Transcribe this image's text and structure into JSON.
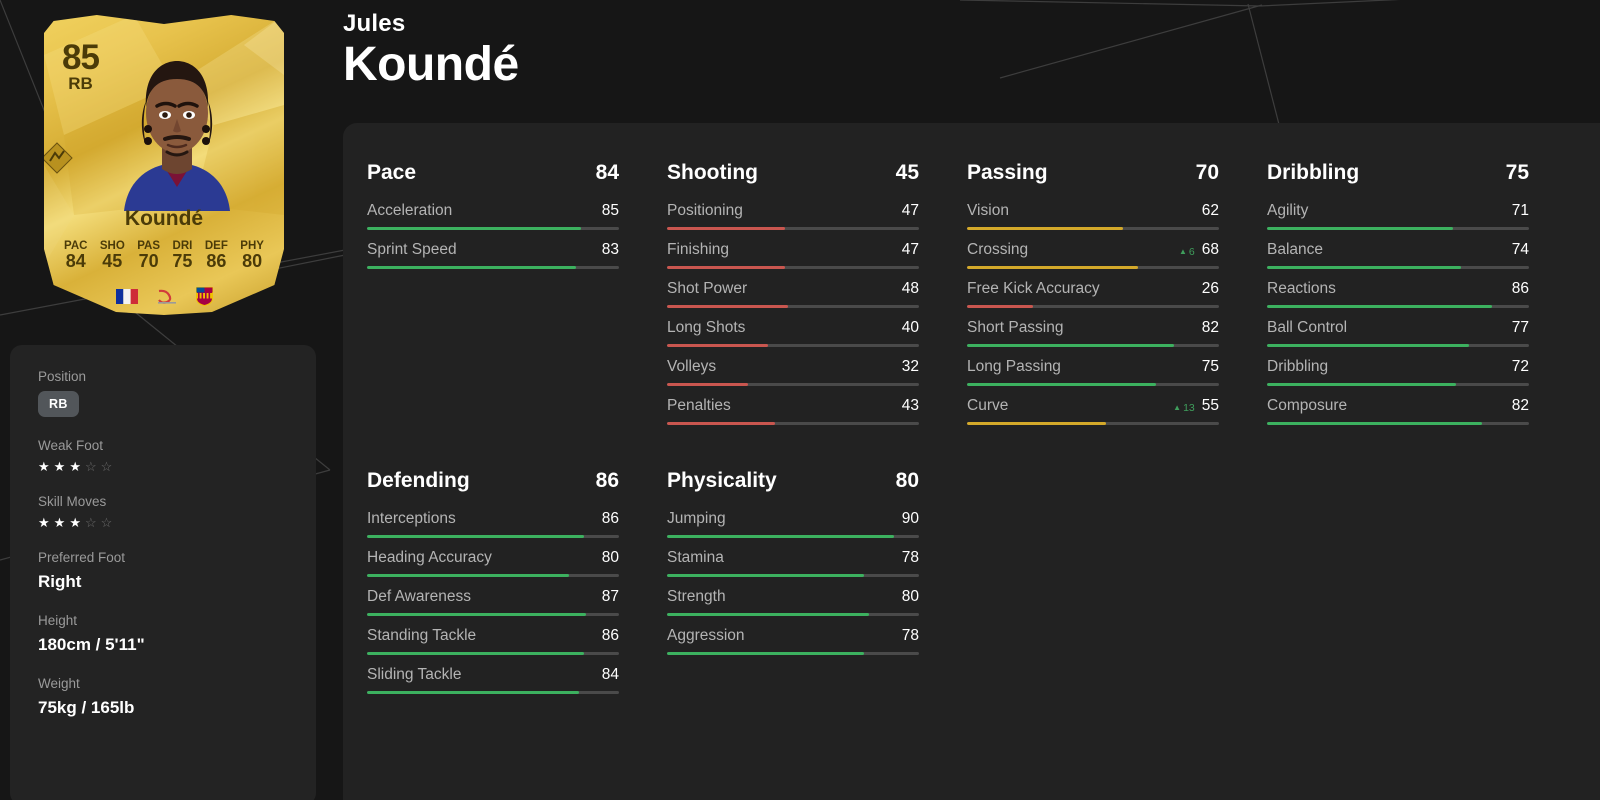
{
  "colors": {
    "background": "#161616",
    "panel": "#222222",
    "info_panel": "#232323",
    "bar_track": "#4a4a4a",
    "green": "#3cb15f",
    "yellow": "#d4a92a",
    "red": "#c9564f",
    "text_primary": "#ffffff",
    "text_muted": "#b4b4b4",
    "card_gold": "#e8c34d"
  },
  "header": {
    "first_name": "Jules",
    "last_name": "Koundé"
  },
  "card": {
    "rating": "85",
    "position": "RB",
    "name": "Koundé",
    "emblem_icon": "club-emblem-icon",
    "photo_icon": "player-photo",
    "stats": [
      {
        "label": "PAC",
        "value": "84"
      },
      {
        "label": "SHO",
        "value": "45"
      },
      {
        "label": "PAS",
        "value": "70"
      },
      {
        "label": "DRI",
        "value": "75"
      },
      {
        "label": "DEF",
        "value": "86"
      },
      {
        "label": "PHY",
        "value": "80"
      }
    ],
    "badges": [
      {
        "name": "nation-flag-france-icon"
      },
      {
        "name": "league-laliga-icon"
      },
      {
        "name": "club-barcelona-crest-icon"
      }
    ]
  },
  "info": {
    "position": {
      "label": "Position",
      "value": "RB"
    },
    "weak_foot": {
      "label": "Weak Foot",
      "value": 3,
      "max": 5
    },
    "skill_moves": {
      "label": "Skill Moves",
      "value": 3,
      "max": 5
    },
    "preferred_foot": {
      "label": "Preferred Foot",
      "value": "Right"
    },
    "height": {
      "label": "Height",
      "value": "180cm / 5'11\""
    },
    "weight": {
      "label": "Weight",
      "value": "75kg / 165lb"
    }
  },
  "chart_data": {
    "type": "bar",
    "title": "Jules Koundé — FC 25 Player Attributes",
    "ylim": [
      0,
      99
    ],
    "grid": false,
    "legend": "none",
    "categories": [
      "Pace",
      "Shooting",
      "Passing",
      "Dribbling",
      "Defending",
      "Physicality"
    ],
    "values": [
      84,
      45,
      70,
      75,
      86,
      80
    ],
    "series": [
      {
        "name": "Pace",
        "total": 84,
        "values": [
          85,
          83
        ],
        "categories": [
          "Acceleration",
          "Sprint Speed"
        ]
      },
      {
        "name": "Shooting",
        "total": 45,
        "values": [
          47,
          47,
          48,
          40,
          32,
          43
        ],
        "categories": [
          "Positioning",
          "Finishing",
          "Shot Power",
          "Long Shots",
          "Volleys",
          "Penalties"
        ]
      },
      {
        "name": "Passing",
        "total": 70,
        "values": [
          62,
          68,
          26,
          82,
          75,
          55
        ],
        "categories": [
          "Vision",
          "Crossing",
          "Free Kick Accuracy",
          "Short Passing",
          "Long Passing",
          "Curve"
        ]
      },
      {
        "name": "Dribbling",
        "total": 75,
        "values": [
          71,
          74,
          86,
          77,
          72,
          82
        ],
        "categories": [
          "Agility",
          "Balance",
          "Reactions",
          "Ball Control",
          "Dribbling",
          "Composure"
        ]
      },
      {
        "name": "Defending",
        "total": 86,
        "values": [
          86,
          80,
          87,
          86,
          84
        ],
        "categories": [
          "Interceptions",
          "Heading Accuracy",
          "Def Awareness",
          "Standing Tackle",
          "Sliding Tackle"
        ]
      },
      {
        "name": "Physicality",
        "total": 80,
        "values": [
          90,
          78,
          80,
          78
        ],
        "categories": [
          "Jumping",
          "Stamina",
          "Strength",
          "Aggression"
        ]
      }
    ]
  },
  "categories": {
    "row1": [
      {
        "name": "Pace",
        "total": "84",
        "subs": [
          {
            "name": "Acceleration",
            "value": "85",
            "bar": 85,
            "color": "green",
            "mod": null
          },
          {
            "name": "Sprint Speed",
            "value": "83",
            "bar": 83,
            "color": "green",
            "mod": null
          }
        ]
      },
      {
        "name": "Shooting",
        "total": "45",
        "subs": [
          {
            "name": "Positioning",
            "value": "47",
            "bar": 47,
            "color": "red",
            "mod": null
          },
          {
            "name": "Finishing",
            "value": "47",
            "bar": 47,
            "color": "red",
            "mod": null
          },
          {
            "name": "Shot Power",
            "value": "48",
            "bar": 48,
            "color": "red",
            "mod": null
          },
          {
            "name": "Long Shots",
            "value": "40",
            "bar": 40,
            "color": "red",
            "mod": null
          },
          {
            "name": "Volleys",
            "value": "32",
            "bar": 32,
            "color": "red",
            "mod": null
          },
          {
            "name": "Penalties",
            "value": "43",
            "bar": 43,
            "color": "red",
            "mod": null
          }
        ]
      },
      {
        "name": "Passing",
        "total": "70",
        "subs": [
          {
            "name": "Vision",
            "value": "62",
            "bar": 62,
            "color": "yellow",
            "mod": null
          },
          {
            "name": "Crossing",
            "value": "68",
            "bar": 68,
            "color": "yellow",
            "mod": "6"
          },
          {
            "name": "Free Kick Accuracy",
            "value": "26",
            "bar": 26,
            "color": "red",
            "mod": null
          },
          {
            "name": "Short Passing",
            "value": "82",
            "bar": 82,
            "color": "green",
            "mod": null
          },
          {
            "name": "Long Passing",
            "value": "75",
            "bar": 75,
            "color": "green",
            "mod": null
          },
          {
            "name": "Curve",
            "value": "55",
            "bar": 55,
            "color": "yellow",
            "mod": "13"
          }
        ]
      },
      {
        "name": "Dribbling",
        "total": "75",
        "subs": [
          {
            "name": "Agility",
            "value": "71",
            "bar": 71,
            "color": "green",
            "mod": null
          },
          {
            "name": "Balance",
            "value": "74",
            "bar": 74,
            "color": "green",
            "mod": null
          },
          {
            "name": "Reactions",
            "value": "86",
            "bar": 86,
            "color": "green",
            "mod": null
          },
          {
            "name": "Ball Control",
            "value": "77",
            "bar": 77,
            "color": "green",
            "mod": null
          },
          {
            "name": "Dribbling",
            "value": "72",
            "bar": 72,
            "color": "green",
            "mod": null
          },
          {
            "name": "Composure",
            "value": "82",
            "bar": 82,
            "color": "green",
            "mod": null
          }
        ]
      }
    ],
    "row2": [
      {
        "name": "Defending",
        "total": "86",
        "subs": [
          {
            "name": "Interceptions",
            "value": "86",
            "bar": 86,
            "color": "green",
            "mod": null
          },
          {
            "name": "Heading Accuracy",
            "value": "80",
            "bar": 80,
            "color": "green",
            "mod": null
          },
          {
            "name": "Def Awareness",
            "value": "87",
            "bar": 87,
            "color": "green",
            "mod": null
          },
          {
            "name": "Standing Tackle",
            "value": "86",
            "bar": 86,
            "color": "green",
            "mod": null
          },
          {
            "name": "Sliding Tackle",
            "value": "84",
            "bar": 84,
            "color": "green",
            "mod": null
          }
        ]
      },
      {
        "name": "Physicality",
        "total": "80",
        "subs": [
          {
            "name": "Jumping",
            "value": "90",
            "bar": 90,
            "color": "green",
            "mod": null
          },
          {
            "name": "Stamina",
            "value": "78",
            "bar": 78,
            "color": "green",
            "mod": null
          },
          {
            "name": "Strength",
            "value": "80",
            "bar": 80,
            "color": "green",
            "mod": null
          },
          {
            "name": "Aggression",
            "value": "78",
            "bar": 78,
            "color": "green",
            "mod": null
          }
        ]
      }
    ]
  }
}
